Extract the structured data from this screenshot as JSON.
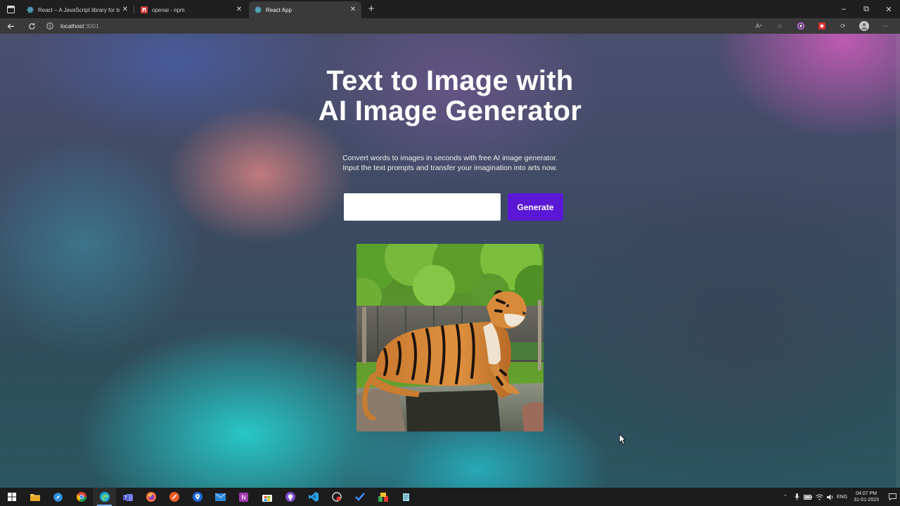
{
  "browser": {
    "tabs": [
      {
        "title": "React – A JavaScript library for b",
        "favicon": "react-icon",
        "active": false
      },
      {
        "title": "openai - npm",
        "favicon": "npm-icon",
        "active": false
      },
      {
        "title": "React App",
        "favicon": "react-icon",
        "active": true
      }
    ],
    "url_host": "localhost",
    "url_port": ":3001",
    "new_tab_symbol": "+",
    "window_controls": {
      "minimize": "–",
      "restore": "⧉",
      "close": "✕"
    }
  },
  "page": {
    "headline_line1": "Text to Image with",
    "headline_line2": "AI Image Generator",
    "subtitle_line1": "Convert words to images in seconds with free AI image generator.",
    "subtitle_line2": "Input the text prompts and transfer your imagination into arts now.",
    "prompt": {
      "value": "",
      "placeholder": ""
    },
    "generate_label": "Generate",
    "accent_color": "#5a17d6",
    "result_image": "tiger lying on a rock in front of green trees"
  },
  "taskbar": {
    "apps": [
      "start-icon",
      "file-explorer-icon",
      "safari-icon",
      "chrome-icon",
      "edge-icon",
      "teams-icon",
      "firefox-icon",
      "postman-icon",
      "maps-icon",
      "mail-icon",
      "onenote-icon",
      "store-icon",
      "github-icon",
      "vscode-icon",
      "screen-recorder-icon",
      "todo-icon",
      "app-installer-icon",
      "notepad-icon"
    ],
    "language": "ENG",
    "time": "04:07 PM",
    "date": "31-01-2023"
  }
}
